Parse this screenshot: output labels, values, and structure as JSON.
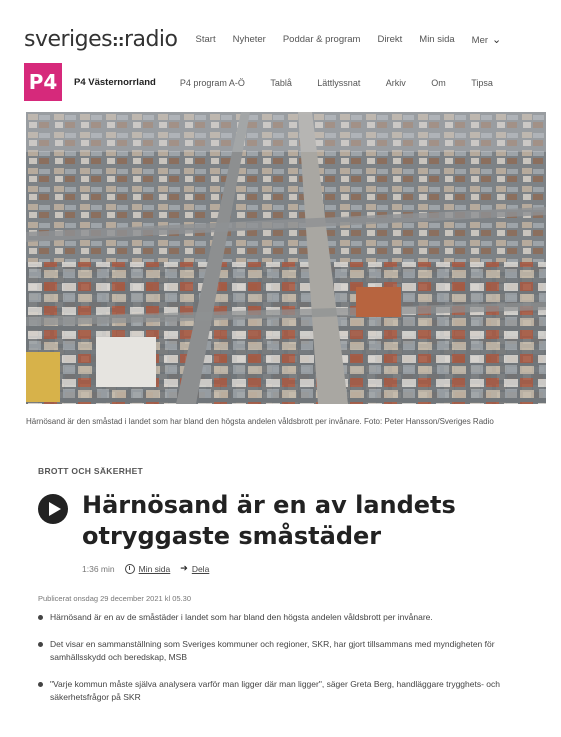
{
  "header": {
    "logo_text": "sveriges",
    "logo_mark": "::",
    "logo_suffix": "radio",
    "nav": [
      "Start",
      "Nyheter",
      "Poddar & program",
      "Direkt",
      "Min sida",
      "Mer"
    ]
  },
  "channel_bar": {
    "badge": "P4",
    "name": "P4 Västernorrland",
    "nav": [
      "P4 program A-Ö",
      "Tablå",
      "Lättlyssnat",
      "Arkiv",
      "Om",
      "Tipsa"
    ]
  },
  "photo": {
    "caption": "Härnösand är den småstad i landet som har bland den högsta andelen våldsbrott per invånare. Foto: Peter Hansson/Sveriges Radio"
  },
  "article": {
    "category": "BROTT OCH SÄKERHET",
    "title": "Härnösand är en av landets otryggaste småstäder",
    "duration": "1:36 min",
    "save_label": "Min sida",
    "share_label": "Dela",
    "published": "Publicerat onsdag 29 december 2021 kl 05.30",
    "bullets": [
      "Härnösand är en av de småstäder i landet som har bland den högsta andelen våldsbrott per invånare.",
      "Det visar en sammanställning som Sveriges kommuner och regioner, SKR, har gjort tillsammans med myndigheten för samhällsskydd och beredskap, MSB",
      "\"Varje kommun måste själva analysera varför man ligger där man ligger\", säger Greta Berg, handläggare trygghets- och säkerhetsfrågor på SKR"
    ]
  },
  "colors": {
    "brand_pink": "#d6297b",
    "text_dark": "#222222"
  }
}
